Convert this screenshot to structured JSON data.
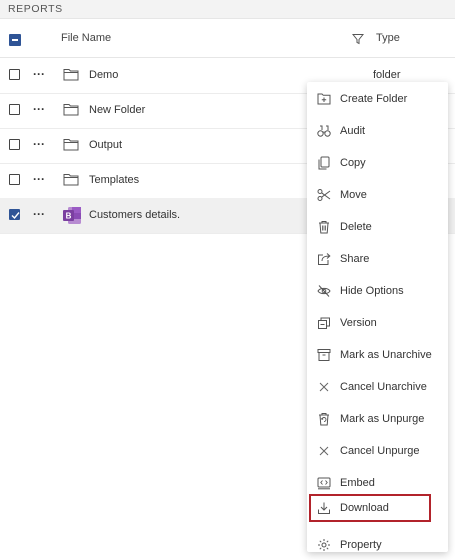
{
  "section": {
    "title": "REPORTS"
  },
  "columns": {
    "file_name": "File Name",
    "type": "Type"
  },
  "rows": [
    {
      "name": "Demo",
      "type": "folder",
      "icon": "folder-icon",
      "checked": false
    },
    {
      "name": "New Folder",
      "type": "",
      "icon": "folder-icon",
      "checked": false
    },
    {
      "name": "Output",
      "type": "",
      "icon": "folder-icon",
      "checked": false
    },
    {
      "name": "Templates",
      "type": "",
      "icon": "folder-icon",
      "checked": false
    },
    {
      "name": "Customers details.",
      "type": "",
      "icon": "onenote-file-icon",
      "checked": true
    }
  ],
  "row_more_label": "···",
  "context_menu": {
    "items": [
      {
        "label": "Create Folder",
        "icon": "create-folder-icon"
      },
      {
        "label": "Audit",
        "icon": "binoculars-icon"
      },
      {
        "label": "Copy",
        "icon": "copy-icon"
      },
      {
        "label": "Move",
        "icon": "scissors-icon"
      },
      {
        "label": "Delete",
        "icon": "trash-icon"
      },
      {
        "label": "Share",
        "icon": "share-icon"
      },
      {
        "label": "Hide Options",
        "icon": "eye-off-icon"
      },
      {
        "label": "Version",
        "icon": "version-icon"
      },
      {
        "label": "Mark as Unarchive",
        "icon": "archive-icon"
      },
      {
        "label": "Cancel Unarchive",
        "icon": "close-icon"
      },
      {
        "label": "Mark as Unpurge",
        "icon": "unpurge-icon"
      },
      {
        "label": "Cancel Unpurge",
        "icon": "close-icon"
      },
      {
        "label": "Embed",
        "icon": "embed-icon"
      },
      {
        "label": "Download",
        "icon": "download-icon"
      },
      {
        "label": "Property",
        "icon": "gear-icon"
      }
    ]
  },
  "colors": {
    "accent": "#2f5496",
    "highlight_border": "#b2232b",
    "onenote": "#7b3fa0"
  }
}
